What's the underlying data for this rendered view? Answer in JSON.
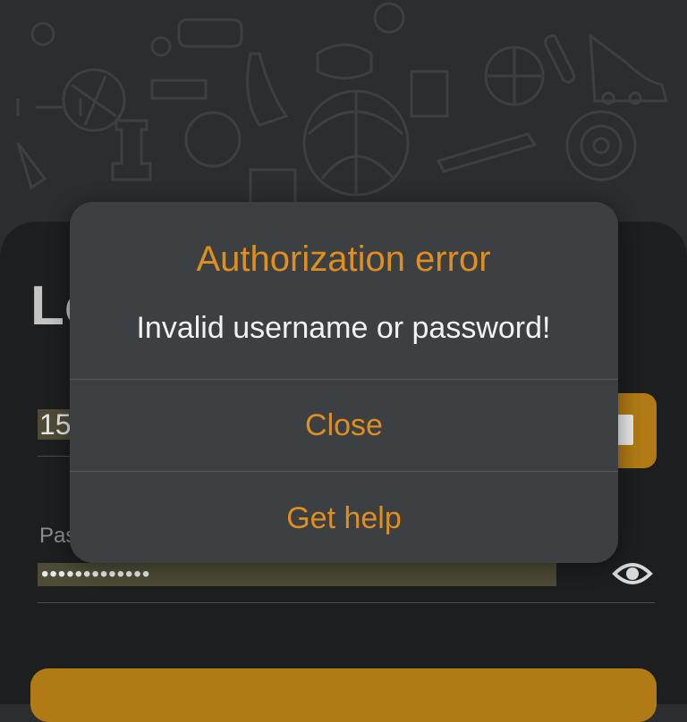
{
  "background": {
    "pattern": "sports-icons-pattern"
  },
  "login": {
    "title": "Log in",
    "username_value": "15",
    "password_label": "Password",
    "password_value": "•••••••••••••",
    "accent_color": "#b07a14"
  },
  "dialog": {
    "title": "Authorization error",
    "message": "Invalid username or password!",
    "buttons": [
      {
        "label": "Close"
      },
      {
        "label": "Get help"
      }
    ],
    "accent_color": "#e08e1e"
  }
}
